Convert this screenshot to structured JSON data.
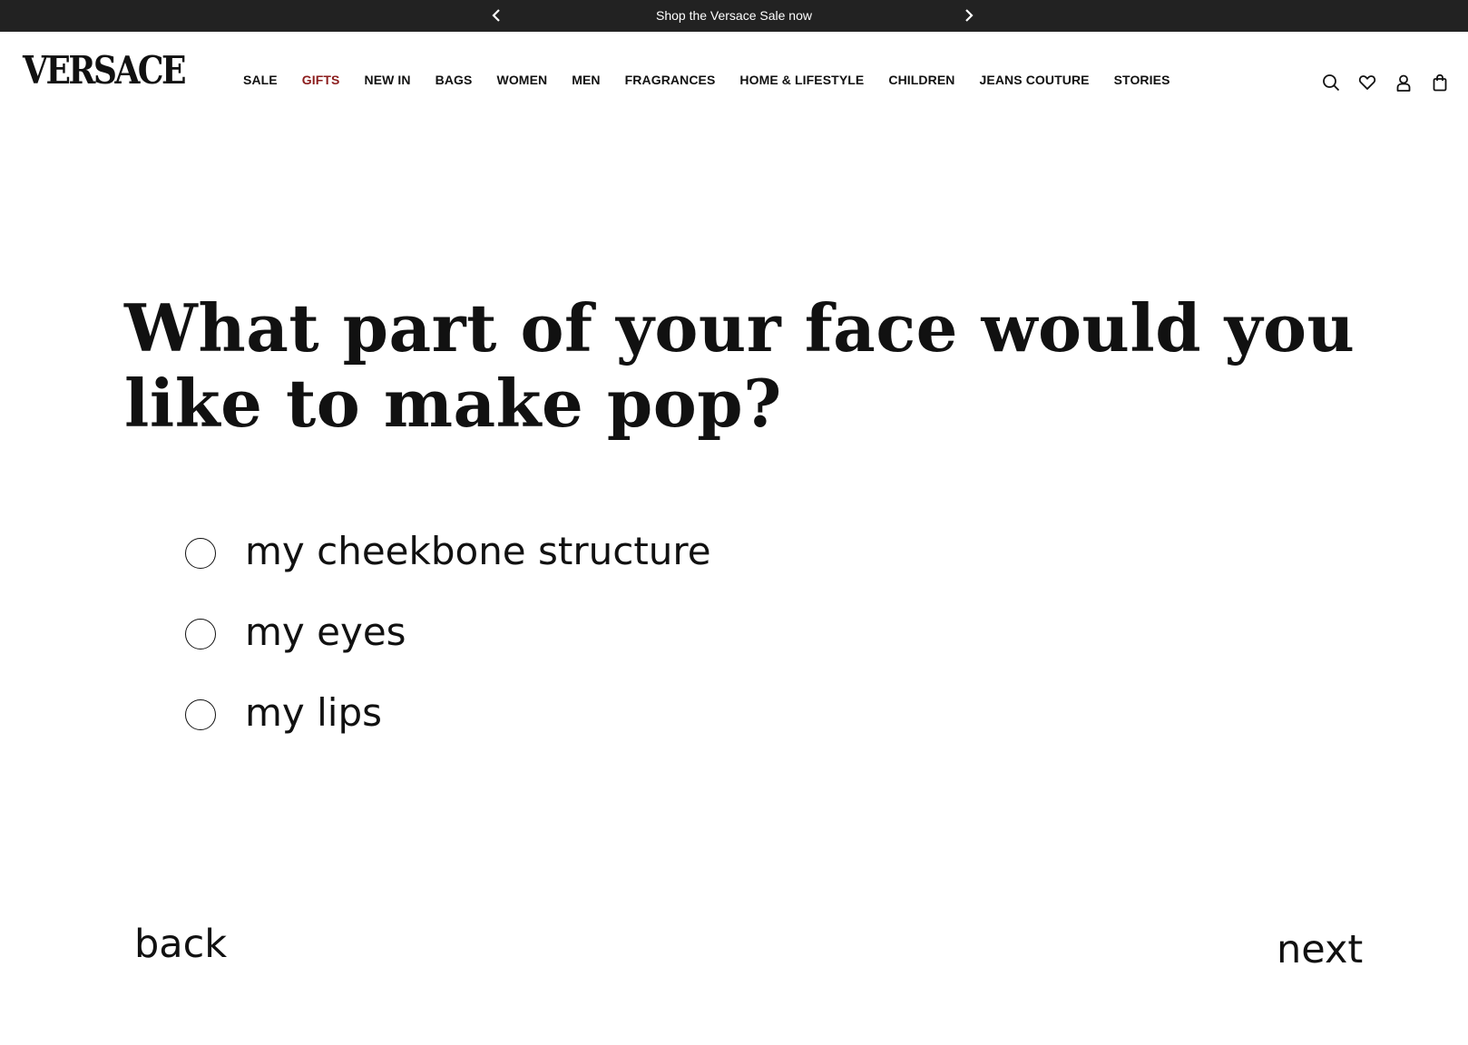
{
  "promo": {
    "text": "Shop the Versace Sale now",
    "prev_icon": "chevron-left-icon",
    "next_icon": "chevron-right-icon"
  },
  "header": {
    "logo": "VERSACE",
    "nav": [
      {
        "label": "SALE"
      },
      {
        "label": "GIFTS",
        "color": "#8b1c1c"
      },
      {
        "label": "NEW IN"
      },
      {
        "label": "BAGS"
      },
      {
        "label": "WOMEN"
      },
      {
        "label": "MEN"
      },
      {
        "label": "FRAGRANCES"
      },
      {
        "label": "HOME & LIFESTYLE"
      },
      {
        "label": "CHILDREN"
      },
      {
        "label": "JEANS COUTURE"
      },
      {
        "label": "STORIES"
      }
    ],
    "icons": [
      "search-icon",
      "heart-icon",
      "account-icon",
      "shopping-bag-icon"
    ]
  },
  "quiz": {
    "question": "What part of your face would you like to make pop?",
    "options": [
      {
        "label": "my cheekbone structure",
        "selected": false
      },
      {
        "label": "my eyes",
        "selected": false
      },
      {
        "label": "my lips",
        "selected": false
      }
    ],
    "back_label": "back",
    "next_label": "next"
  },
  "colors": {
    "promo_bg": "#222222",
    "text": "#111111",
    "highlight": "#8b1c1c"
  }
}
